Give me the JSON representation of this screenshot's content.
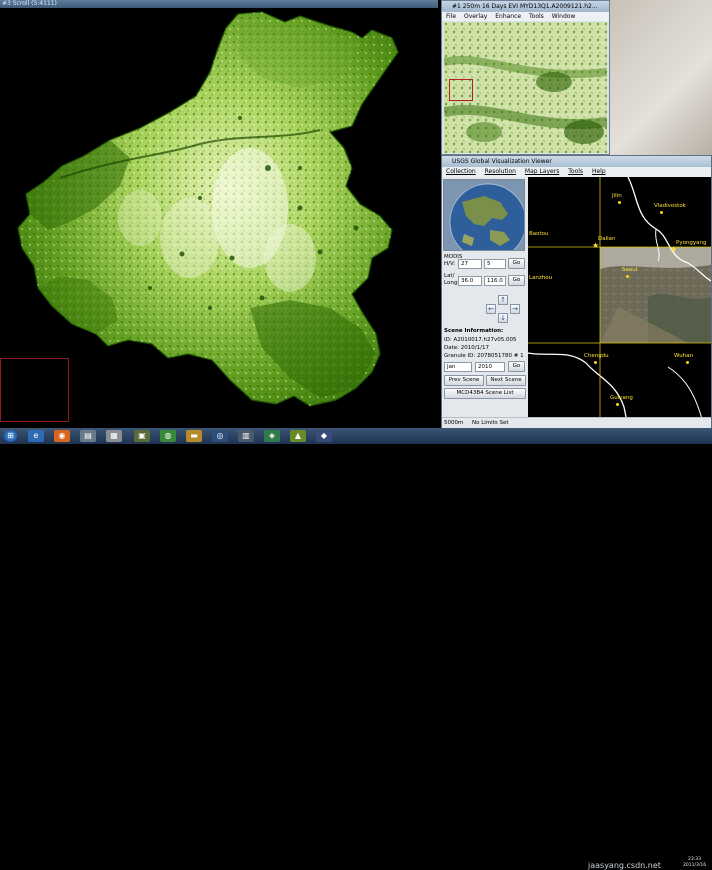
{
  "scroll_window": {
    "title": "#3 Scroll (5:4111)"
  },
  "image_window": {
    "title": "#1 250m 16 Days EVI MYD13Q1.A2009121.h2...",
    "menu": [
      "File",
      "Overlay",
      "Enhance",
      "Tools",
      "Window"
    ]
  },
  "glovis": {
    "title": "USGS Global Visualization Viewer",
    "menu": [
      "Collection",
      "Resolution",
      "Map Layers",
      "Tools",
      "Help"
    ],
    "modis_label": "MODIS",
    "hv_label": "H/V:",
    "h_value": "27",
    "v_value": "5",
    "go_label": "Go",
    "lat_label": "Lat/",
    "long_label": "Long:",
    "lat_value": "36.0",
    "long_value": "116.0",
    "scene_info_label": "Scene Information:",
    "scene_id": "ID: A2010017.h27v05.005",
    "scene_date": "Date: 2010/1/17",
    "granule_id": "Granule ID: 2078051780  # 1",
    "month_value": "Jan",
    "year_value": "2010",
    "prev_scene": "Prev Scene",
    "next_scene": "Next Scene",
    "scene_list": "MCD43B4 Scene List",
    "status_resolution": "5000m",
    "status_limits": "No Limits Set",
    "cities": [
      {
        "name": "Jilin"
      },
      {
        "name": "Vladivostok"
      },
      {
        "name": "Dalian"
      },
      {
        "name": "Pyongyang"
      },
      {
        "name": "Seoul"
      },
      {
        "name": "Chengdu"
      },
      {
        "name": "Wuhan"
      },
      {
        "name": "Guiyang"
      },
      {
        "name": "Baotou"
      },
      {
        "name": "Lanzhou"
      }
    ]
  },
  "taskbar": {
    "clock_time": "23:33",
    "clock_date": "2011/3/16",
    "watermark": "jaasyang.csdn.net"
  },
  "colors": {
    "vegetation_dark": "#1f5c00",
    "vegetation_mid": "#4f8f1a",
    "vegetation_light": "#b7d86a",
    "selection_red": "#b22222",
    "city_yellow": "#ffd800"
  }
}
